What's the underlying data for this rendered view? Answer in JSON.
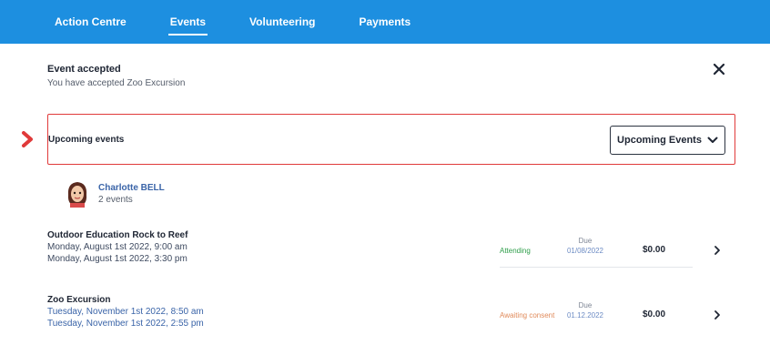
{
  "nav": {
    "items": [
      {
        "label": "Action Centre",
        "active": false
      },
      {
        "label": "Events",
        "active": true
      },
      {
        "label": "Volunteering",
        "active": false
      },
      {
        "label": "Payments",
        "active": false
      }
    ],
    "colors": {
      "bar": "#1d8fe0",
      "text": "#ffffff"
    }
  },
  "notice": {
    "title": "Event accepted",
    "body": "You have accepted Zoo Excursion"
  },
  "upcoming": {
    "label": "Upcoming events",
    "dropdown_value": "Upcoming Events",
    "highlight_color": "#e03a3a"
  },
  "person": {
    "name": "Charlotte BELL",
    "count": "2 events"
  },
  "events": [
    {
      "title": "Outdoor Education Rock to Reef",
      "start": "Monday, August 1st 2022, 9:00 am",
      "end": "Monday, August 1st 2022, 3:30 pm",
      "status": "Attending",
      "status_color": "#2e9e4a",
      "due_label": "Due",
      "due_date": "01/08/2022",
      "amount": "$0.00"
    },
    {
      "title": "Zoo Excursion",
      "start": "Tuesday, November 1st 2022, 8:50 am",
      "end": "Tuesday, November 1st 2022, 2:55 pm",
      "status": "Awaiting consent",
      "status_color": "#e08a5a",
      "due_label": "Due",
      "due_date": "01.12.2022",
      "amount": "$0.00"
    }
  ]
}
